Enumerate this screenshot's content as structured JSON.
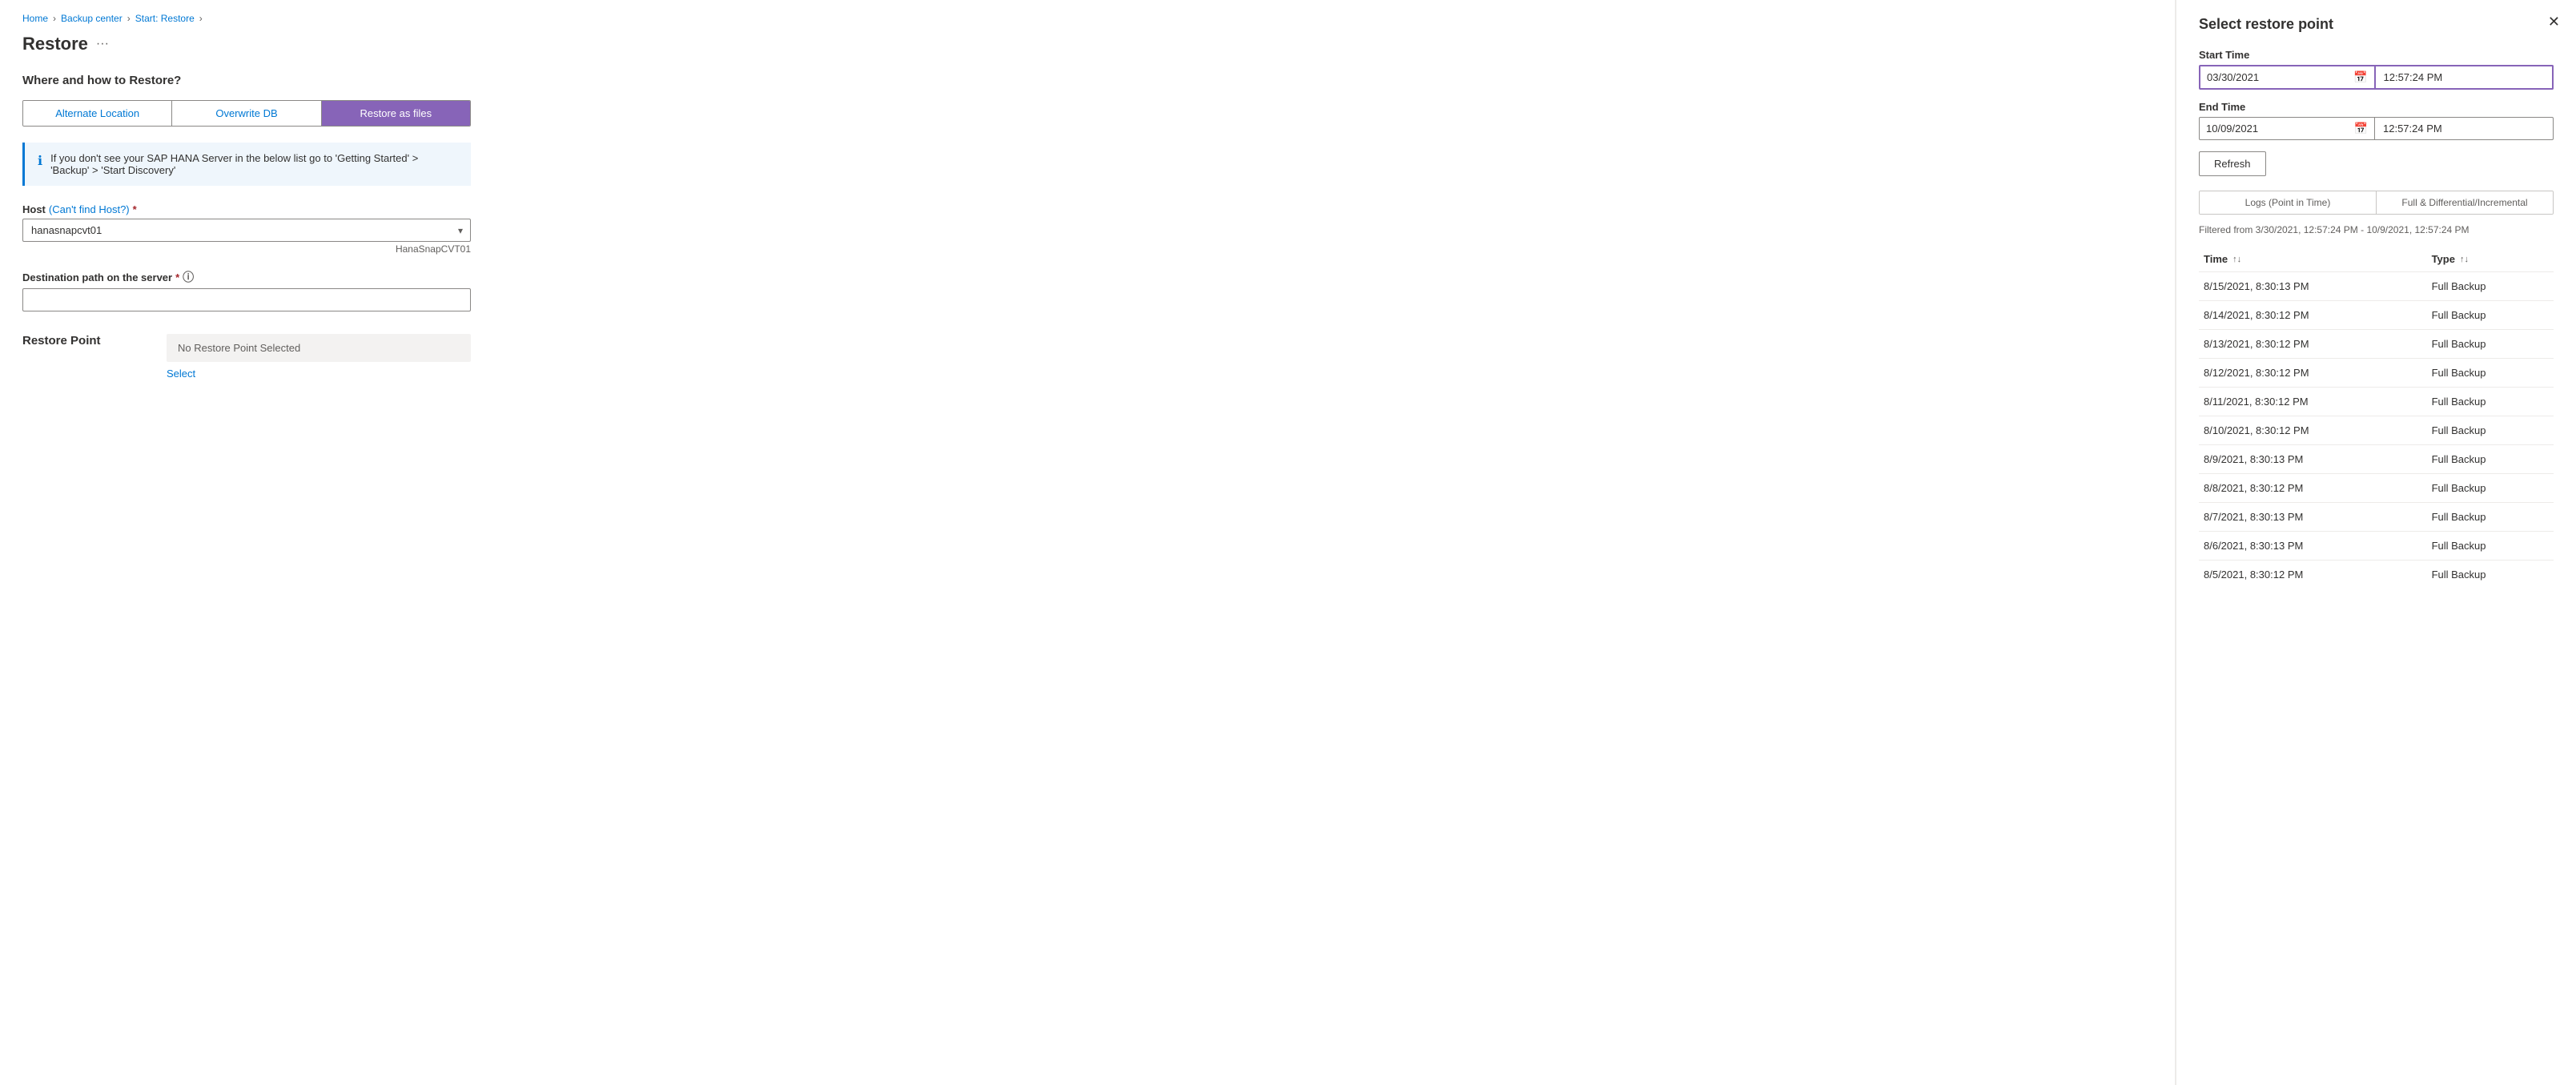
{
  "breadcrumb": {
    "home": "Home",
    "backup_center": "Backup center",
    "start_restore": "Start: Restore",
    "separator": "›"
  },
  "page": {
    "title": "Restore",
    "ellipsis": "···"
  },
  "form": {
    "section_heading": "Where and how to Restore?",
    "tabs": [
      {
        "id": "alternate",
        "label": "Alternate Location",
        "active": false
      },
      {
        "id": "overwrite",
        "label": "Overwrite DB",
        "active": false
      },
      {
        "id": "restore_files",
        "label": "Restore as files",
        "active": true
      }
    ],
    "info_text": "If you don't see your SAP HANA Server in the below list go to 'Getting Started' > 'Backup' > 'Start Discovery'",
    "host_label": "Host",
    "host_link": "(Can't find Host?)",
    "host_required": true,
    "host_value": "hanasnapcvt01",
    "host_hint": "HanaSnapCVT01",
    "host_options": [
      "hanasnapcvt01"
    ],
    "destination_label": "Destination path on the server",
    "destination_required": true,
    "destination_value": "",
    "destination_placeholder": "",
    "restore_point_section_label": "Restore Point",
    "restore_point_placeholder": "No Restore Point Selected",
    "select_link": "Select"
  },
  "side_panel": {
    "title": "Select restore point",
    "start_time_label": "Start Time",
    "start_date": "03/30/2021",
    "start_time": "12:57:24 PM",
    "end_time_label": "End Time",
    "end_date": "10/09/2021",
    "end_time": "12:57:24 PM",
    "refresh_label": "Refresh",
    "toggle_logs": "Logs (Point in Time)",
    "toggle_full": "Full & Differential/Incremental",
    "filter_text": "Filtered from 3/30/2021, 12:57:24 PM - 10/9/2021, 12:57:24 PM",
    "table_col_time": "Time",
    "table_col_type": "Type",
    "rows": [
      {
        "time": "8/15/2021, 8:30:13 PM",
        "type": "Full Backup"
      },
      {
        "time": "8/14/2021, 8:30:12 PM",
        "type": "Full Backup"
      },
      {
        "time": "8/13/2021, 8:30:12 PM",
        "type": "Full Backup"
      },
      {
        "time": "8/12/2021, 8:30:12 PM",
        "type": "Full Backup"
      },
      {
        "time": "8/11/2021, 8:30:12 PM",
        "type": "Full Backup"
      },
      {
        "time": "8/10/2021, 8:30:12 PM",
        "type": "Full Backup"
      },
      {
        "time": "8/9/2021, 8:30:13 PM",
        "type": "Full Backup"
      },
      {
        "time": "8/8/2021, 8:30:12 PM",
        "type": "Full Backup"
      },
      {
        "time": "8/7/2021, 8:30:13 PM",
        "type": "Full Backup"
      },
      {
        "time": "8/6/2021, 8:30:13 PM",
        "type": "Full Backup"
      },
      {
        "time": "8/5/2021, 8:30:12 PM",
        "type": "Full Backup"
      }
    ]
  }
}
